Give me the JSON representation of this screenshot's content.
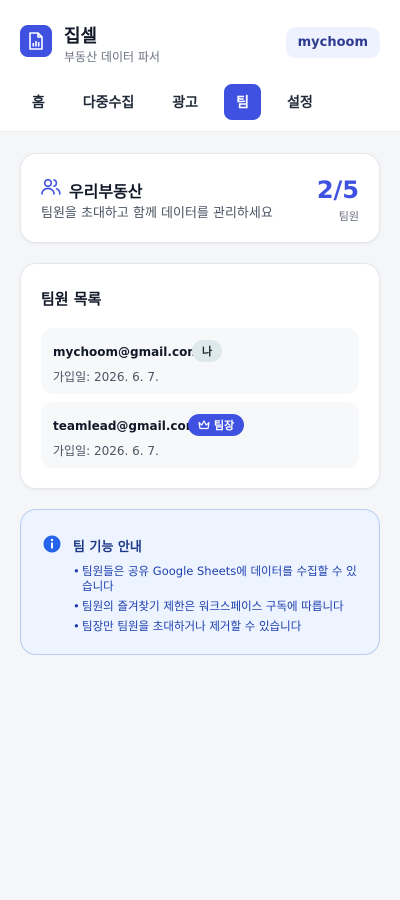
{
  "app": {
    "title": "집셀",
    "subtitle": "부동산 데이터 파서",
    "user": "mychoom",
    "logo_icon": "document-chart-icon",
    "accent_color": "#3f51e0"
  },
  "tabs": [
    {
      "label": "홈",
      "active": false
    },
    {
      "label": "다중수집",
      "active": false
    },
    {
      "label": "광고",
      "active": false
    },
    {
      "label": "팀",
      "active": true
    },
    {
      "label": "설정",
      "active": false
    }
  ],
  "team": {
    "name": "우리부동산",
    "description": "팀원을 초대하고 함께 데이터를 관리하세요",
    "count": "2/5",
    "count_label": "팀원",
    "icon": "users-icon"
  },
  "members": {
    "title": "팀원 목록",
    "items": [
      {
        "email": "mychoom@gmail.com",
        "joined": "가입일: 2026. 6. 7.",
        "badge": "나"
      },
      {
        "email": "teamlead@gmail.com",
        "joined": "가입일: 2026. 6. 7.",
        "badge": "팀장",
        "badge_icon": "crown-icon"
      }
    ]
  },
  "info": {
    "icon": "info-icon",
    "title": "팀 기능 안내",
    "items": [
      "팀원들은 공유 Google Sheets에 데이터를 수집할 수 있습니다",
      "팀원의 즐겨찾기 제한은 워크스페이스 구독에 따릅니다",
      "팀장만 팀원을 초대하거나 제거할 수 있습니다"
    ]
  }
}
